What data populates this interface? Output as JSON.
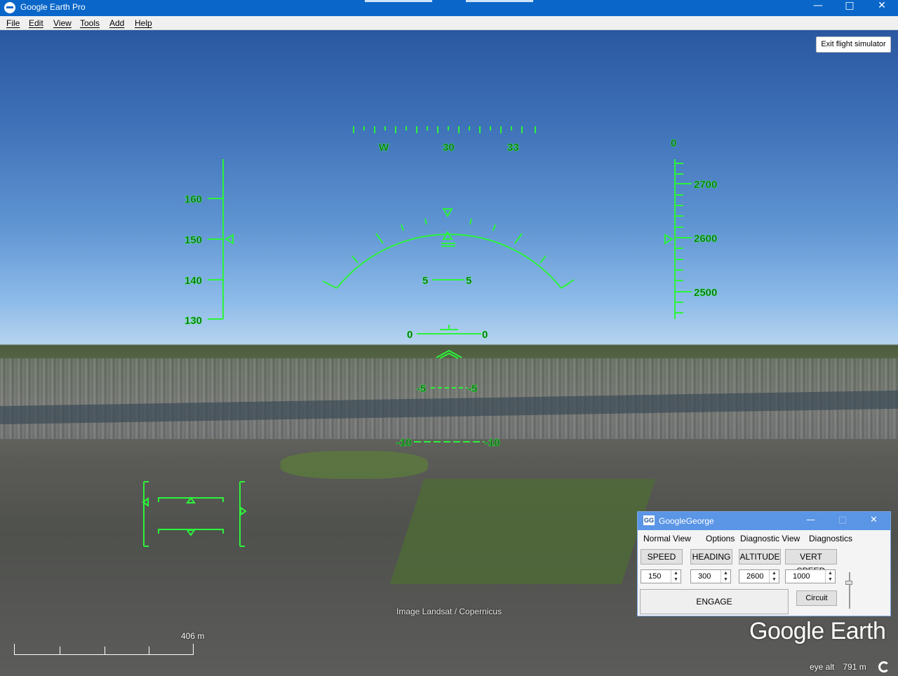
{
  "window": {
    "title": "Google Earth Pro",
    "minimize_icon": "minimize-icon",
    "maximize_icon": "maximize-icon",
    "close_icon": "close-icon"
  },
  "menu": [
    "File",
    "Edit",
    "View",
    "Tools",
    "Add",
    "Help"
  ],
  "viewport": {
    "exit_button": "Exit flight simulator",
    "attribution": "Image Landsat / Copernicus",
    "scale_label": "406 m",
    "logo": "Google Earth",
    "eye_alt_label": "eye alt",
    "eye_alt_value": "791 m"
  },
  "hud": {
    "heading_labels": [
      "W",
      "30",
      "33"
    ],
    "vertical_speed_label": "0",
    "speed_labels": [
      "160",
      "150",
      "140",
      "130"
    ],
    "altitude_labels": [
      "2700",
      "2600",
      "2500"
    ],
    "pitch_labels": [
      "5",
      "5",
      "0",
      "0",
      "-5",
      "-5",
      "-10",
      "-10"
    ],
    "color": "#2cf33a"
  },
  "googlegeorge": {
    "title": "GoogleGeorge",
    "icon_text": "GG",
    "menu": [
      "Normal View",
      "Options",
      "Diagnostic View",
      "Diagnostics"
    ],
    "buttons": [
      "SPEED",
      "HEADING",
      "ALTITUDE",
      "VERT SPEED"
    ],
    "values": [
      "150",
      "300",
      "2600",
      "1000"
    ],
    "engage": "ENGAGE",
    "circuit": "Circuit"
  }
}
